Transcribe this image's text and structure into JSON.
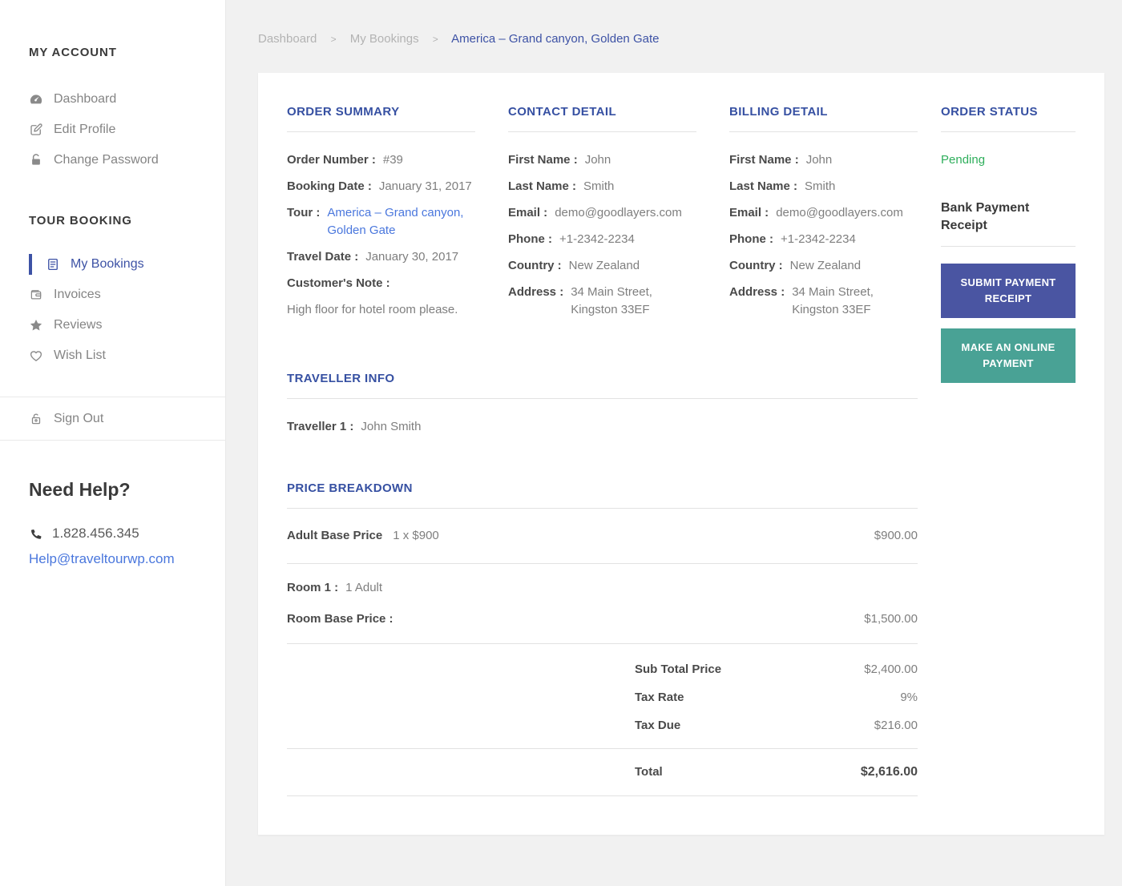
{
  "breadcrumb": {
    "separator": ">",
    "items": [
      {
        "label": "Dashboard"
      },
      {
        "label": "My Bookings"
      },
      {
        "label": "America – Grand canyon, Golden Gate"
      }
    ]
  },
  "sidebar": {
    "my_account": {
      "heading": "MY ACCOUNT",
      "items": [
        {
          "label": "Dashboard",
          "icon": "dashboard-icon"
        },
        {
          "label": "Edit Profile",
          "icon": "edit-icon"
        },
        {
          "label": "Change Password",
          "icon": "lock-icon"
        }
      ]
    },
    "tour_booking": {
      "heading": "TOUR BOOKING",
      "items": [
        {
          "label": "My Bookings",
          "icon": "document-icon",
          "active": true
        },
        {
          "label": "Invoices",
          "icon": "wallet-icon",
          "active": false
        },
        {
          "label": "Reviews",
          "icon": "star-icon",
          "active": false
        },
        {
          "label": "Wish List",
          "icon": "heart-icon",
          "active": false
        }
      ]
    },
    "sign_out": {
      "label": "Sign Out",
      "icon": "unlock-icon"
    },
    "help": {
      "heading": "Need Help?",
      "phone": "1.828.456.345",
      "email": "Help@traveltourwp.com"
    }
  },
  "order_summary": {
    "heading": "ORDER SUMMARY",
    "rows": [
      {
        "label": "Order Number :",
        "value": "#39"
      },
      {
        "label": "Booking Date :",
        "value": "January 31, 2017"
      },
      {
        "label": "Tour :",
        "value": "America – Grand canyon, Golden Gate"
      },
      {
        "label": "Travel Date :",
        "value": "January 30, 2017"
      },
      {
        "label": "Customer's Note :",
        "value": ""
      }
    ],
    "note": "High floor for hotel room please."
  },
  "contact_detail": {
    "heading": "CONTACT DETAIL",
    "rows": [
      {
        "label": "First Name :",
        "value": "John"
      },
      {
        "label": "Last Name :",
        "value": "Smith"
      },
      {
        "label": "Email :",
        "value": "demo@goodlayers.com"
      },
      {
        "label": "Phone :",
        "value": "+1-2342-2234"
      },
      {
        "label": "Country :",
        "value": "New Zealand"
      },
      {
        "label": "Address :",
        "value": "34 Main Street, Kingston 33EF"
      }
    ]
  },
  "billing_detail": {
    "heading": "BILLING DETAIL",
    "rows": [
      {
        "label": "First Name :",
        "value": "John"
      },
      {
        "label": "Last Name :",
        "value": "Smith"
      },
      {
        "label": "Email :",
        "value": "demo@goodlayers.com"
      },
      {
        "label": "Phone :",
        "value": "+1-2342-2234"
      },
      {
        "label": "Country :",
        "value": "New Zealand"
      },
      {
        "label": "Address :",
        "value": "34 Main Street, Kingston 33EF"
      }
    ]
  },
  "order_status": {
    "heading": "ORDER STATUS",
    "status": "Pending",
    "receipt_label": "Bank Payment Receipt",
    "buttons": [
      {
        "label": "SUBMIT PAYMENT RECEIPT"
      },
      {
        "label": "MAKE AN ONLINE PAYMENT"
      }
    ]
  },
  "traveller_info": {
    "heading": "TRAVELLER INFO",
    "rows": [
      {
        "label": "Traveller 1 :",
        "value": "John Smith"
      }
    ]
  },
  "price_breakdown": {
    "heading": "PRICE BREAKDOWN",
    "adult_row": {
      "label": "Adult Base Price",
      "qty": "1 x $900",
      "amount": "$900.00"
    },
    "room_row": {
      "room_label": "Room 1 :",
      "room_value": "1 Adult",
      "price_label": "Room Base Price :",
      "amount": "$1,500.00"
    },
    "totals": [
      {
        "label": "Sub Total Price",
        "value": "$2,400.00"
      },
      {
        "label": "Tax Rate",
        "value": "9%"
      },
      {
        "label": "Tax Due",
        "value": "$216.00"
      }
    ],
    "total": {
      "label": "Total",
      "value": "$2,616.00"
    }
  },
  "colors": {
    "heading_blue": "#3650a2",
    "active_indigo": "#3d52a5",
    "link_blue": "#4a77dd",
    "status_green": "#2eae5b",
    "button_indigo": "#4a55a2",
    "button_teal": "#49a295",
    "page_background": "#f1f1f1"
  }
}
